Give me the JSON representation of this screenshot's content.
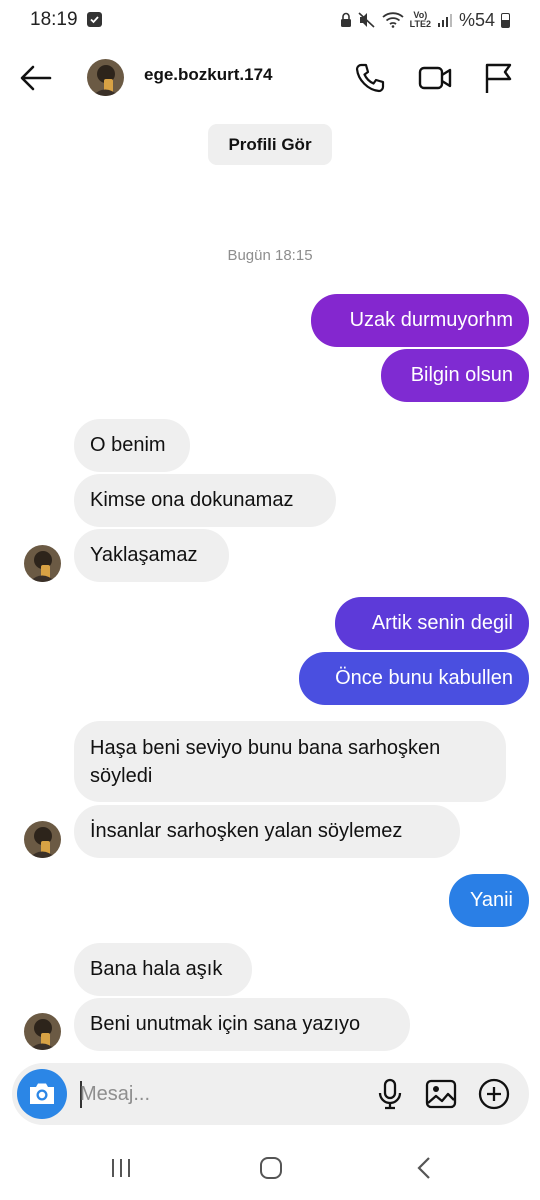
{
  "status_bar": {
    "time": "18:19",
    "volte_top": "Vo)",
    "volte_bottom": "LTE2",
    "battery": "%54"
  },
  "header": {
    "username": "ege.bozkurt.174",
    "icons": [
      "back-arrow-icon",
      "phone-icon",
      "video-camera-icon",
      "flag-icon"
    ]
  },
  "profile_button": "Profili Gör",
  "timestamp": "Bugün 18:15",
  "messages": [
    {
      "from": "me",
      "text": "Uzak durmuyorhm"
    },
    {
      "from": "me",
      "text": "Bilgin olsun"
    },
    {
      "from": "them",
      "text": "O benim"
    },
    {
      "from": "them",
      "text": "Kimse ona dokunamaz"
    },
    {
      "from": "them",
      "text": "Yaklaşamaz"
    },
    {
      "from": "me",
      "text": "Artik senin degil"
    },
    {
      "from": "me",
      "text": "Önce bunu kabullen"
    },
    {
      "from": "them",
      "text": "Haşa beni seviyo bunu bana sarhoşken söyledi"
    },
    {
      "from": "them",
      "text": "İnsanlar sarhoşken yalan söylemez"
    },
    {
      "from": "me",
      "text": "Yanii"
    },
    {
      "from": "them",
      "text": "Bana hala aşık"
    },
    {
      "from": "them",
      "text": "Beni unutmak için sana yazıyo"
    }
  ],
  "composer": {
    "placeholder": "Mesaj...",
    "icons": [
      "camera-icon",
      "microphone-icon",
      "gallery-icon",
      "add-icon"
    ]
  },
  "colors": {
    "bubble_purple": "#8427cf",
    "bubble_violet": "#6a35d8",
    "bubble_indigo": "#4a4fe0",
    "bubble_blue": "#2a7fe6",
    "incoming_bg": "#efefef",
    "camera_blue": "#2b86e6"
  }
}
